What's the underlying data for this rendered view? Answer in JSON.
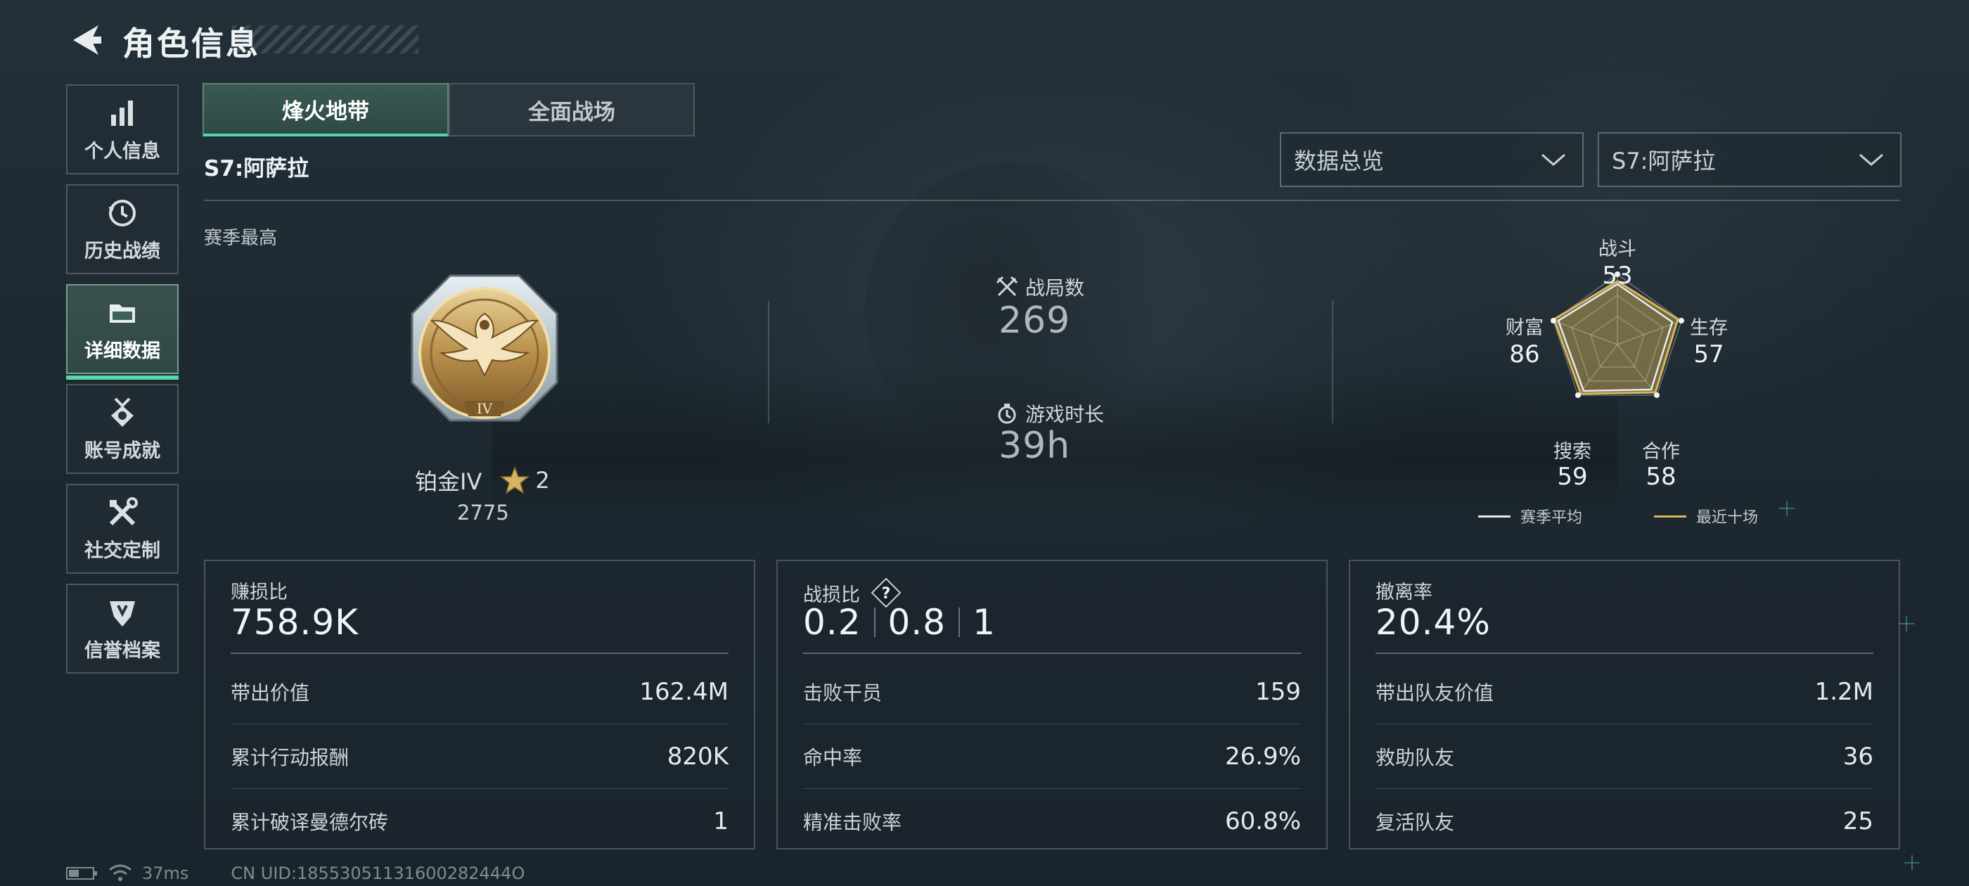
{
  "header": {
    "title": "角色信息",
    "back_icon": "back-arrow-icon"
  },
  "sidebar": {
    "items": [
      {
        "label": "个人信息",
        "icon": "bar-chart-icon"
      },
      {
        "label": "历史战绩",
        "icon": "history-clock-icon"
      },
      {
        "label": "详细数据",
        "icon": "folder-icon",
        "active": true
      },
      {
        "label": "账号成就",
        "icon": "achievement-medal-icon"
      },
      {
        "label": "社交定制",
        "icon": "crossed-tools-icon"
      },
      {
        "label": "信誉档案",
        "icon": "shield-badge-icon"
      }
    ]
  },
  "mode_tabs": [
    {
      "label": "烽火地带",
      "active": true
    },
    {
      "label": "全面战场",
      "active": false
    }
  ],
  "season": {
    "name": "S7:阿萨拉",
    "best_label": "赛季最高"
  },
  "dropdowns": {
    "view": "数据总览",
    "season": "S7:阿萨拉"
  },
  "rank": {
    "name": "铂金IV",
    "stars": "2",
    "score": "2775",
    "badge_icon": "platinum-eagle-badge-icon"
  },
  "matches": {
    "label": "战局数",
    "value": "269",
    "icon": "crossed-swords-icon"
  },
  "playtime": {
    "label": "游戏时长",
    "value": "39h",
    "icon": "stopwatch-icon"
  },
  "radar": {
    "axes": [
      {
        "label": "战斗",
        "value": "53"
      },
      {
        "label": "生存",
        "value": "57"
      },
      {
        "label": "合作",
        "value": "58"
      },
      {
        "label": "搜索",
        "value": "59"
      },
      {
        "label": "财富",
        "value": "86"
      }
    ],
    "legend": [
      {
        "label": "赛季平均",
        "color": "#e8ecef"
      },
      {
        "label": "最近十场",
        "color": "#d8b65a"
      }
    ]
  },
  "panels": [
    {
      "title": "赚损比",
      "big_value": "758.9K",
      "rows": [
        {
          "label": "带出价值",
          "value": "162.4M"
        },
        {
          "label": "累计行动报酬",
          "value": "820K"
        },
        {
          "label": "累计破译曼德尔砖",
          "value": "1"
        }
      ]
    },
    {
      "title": "战损比",
      "big_values": [
        "0.2",
        "0.8",
        "1"
      ],
      "help_icon": "question-diamond-icon",
      "rows": [
        {
          "label": "击败干员",
          "value": "159"
        },
        {
          "label": "命中率",
          "value": "26.9%"
        },
        {
          "label": "精准击败率",
          "value": "60.8%"
        }
      ]
    },
    {
      "title": "撤离率",
      "big_value": "20.4%",
      "rows": [
        {
          "label": "带出队友价值",
          "value": "1.2M"
        },
        {
          "label": "救助队友",
          "value": "36"
        },
        {
          "label": "复活队友",
          "value": "25"
        }
      ]
    }
  ],
  "footer": {
    "ping": "37ms",
    "uid": "CN UID:18553051131600282444O"
  },
  "colors": {
    "accent": "#56d6a8",
    "gold": "#d8b65a"
  }
}
